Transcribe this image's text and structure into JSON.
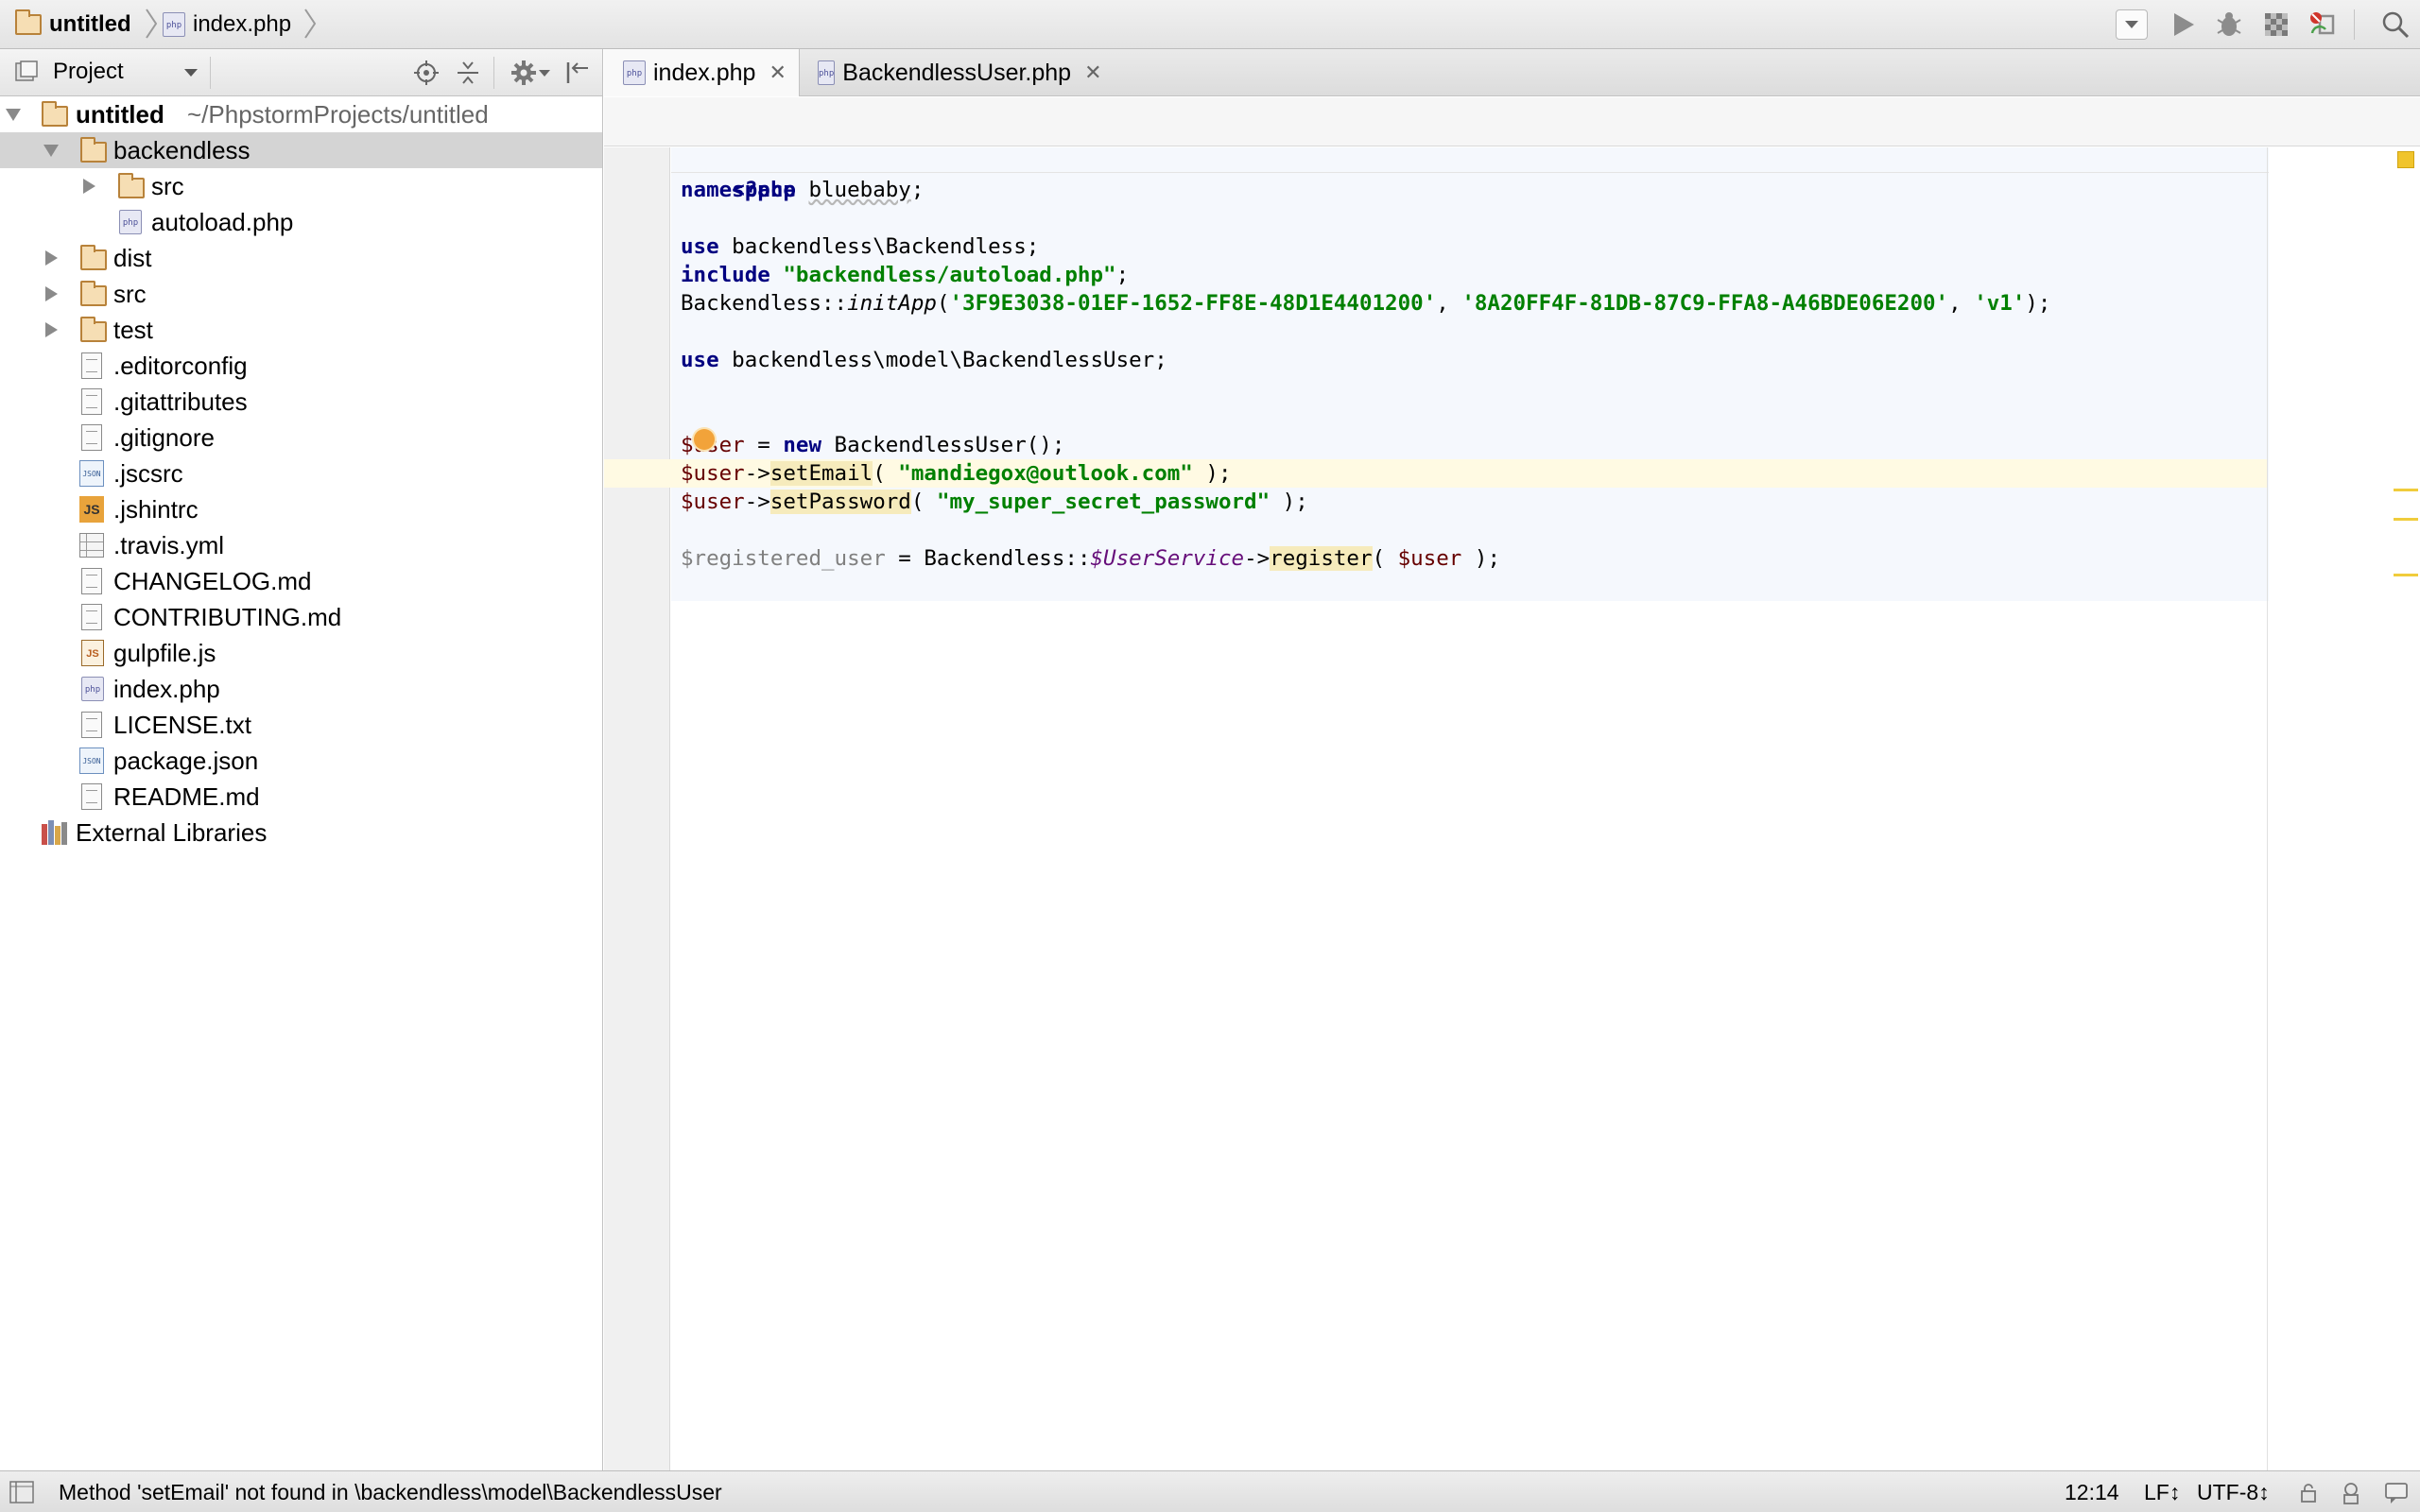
{
  "breadcrumb": {
    "project": "untitled",
    "file": "index.php"
  },
  "toolbar": {
    "run_config_dropdown": "chevron-down-icon",
    "buttons": [
      "run-icon",
      "debug-icon",
      "coverage-icon",
      "stop-icon",
      "search-icon"
    ]
  },
  "project_panel": {
    "title": "Project",
    "tree": {
      "root_name": "untitled",
      "root_path": "~/PhpstormProjects/untitled",
      "items": [
        {
          "label": "backendless",
          "type": "folder"
        },
        {
          "label": "src",
          "type": "folder"
        },
        {
          "label": "autoload.php",
          "type": "php"
        },
        {
          "label": "dist",
          "type": "folder"
        },
        {
          "label": "src",
          "type": "folder"
        },
        {
          "label": "test",
          "type": "folder"
        },
        {
          "label": ".editorconfig",
          "type": "text"
        },
        {
          "label": ".gitattributes",
          "type": "text"
        },
        {
          "label": ".gitignore",
          "type": "text"
        },
        {
          "label": ".jscsrc",
          "type": "json"
        },
        {
          "label": ".jshintrc",
          "type": "js"
        },
        {
          "label": ".travis.yml",
          "type": "yml"
        },
        {
          "label": "CHANGELOG.md",
          "type": "text"
        },
        {
          "label": "CONTRIBUTING.md",
          "type": "text"
        },
        {
          "label": "gulpfile.js",
          "type": "jsfile"
        },
        {
          "label": "index.php",
          "type": "php"
        },
        {
          "label": "LICENSE.txt",
          "type": "text"
        },
        {
          "label": "package.json",
          "type": "json"
        },
        {
          "label": "README.md",
          "type": "text"
        }
      ],
      "external": "External Libraries"
    }
  },
  "editor": {
    "tabs": [
      {
        "label": "index.php",
        "active": true
      },
      {
        "label": "BackendlessUser.php",
        "active": false
      }
    ],
    "code": {
      "l1": "<?php",
      "l2_kw": "namespace",
      "l2_ns": "bluebaby",
      "l2_end": ";",
      "l4_kw": "use",
      "l4_rest": " backendless\\Backendless;",
      "l5_kw": "include",
      "l5_str": "\"backendless/autoload.php\"",
      "l5_end": ";",
      "l6_cls": "Backendless::",
      "l6_fn": "initApp",
      "l6_open": "(",
      "l6_a1": "'3F9E3038-01EF-1652-FF8E-48D1E4401200'",
      "l6_c1": ", ",
      "l6_a2": "'8A20FF4F-81DB-87C9-FFA8-A46BDE06E200'",
      "l6_c2": ", ",
      "l6_a3": "'v1'",
      "l6_end": ");",
      "l8_kw": "use",
      "l8_rest": " backendless\\model\\BackendlessUser;",
      "l11_var": "$user",
      "l11_eq": " = ",
      "l11_kw": "new",
      "l11_rest": " BackendlessUser();",
      "l12_var": "$user",
      "l12_arrow": "->",
      "l12_fn": "setEmail",
      "l12_open": "( ",
      "l12_str": "\"mandiegox@outlook.com\"",
      "l12_end": " );",
      "l13_var": "$user",
      "l13_arrow": "->",
      "l13_fn": "setPassword",
      "l13_open": "( ",
      "l13_str": "\"my_super_secret_password\"",
      "l13_end": " );",
      "l15_var": "$registered_user",
      "l15_eq": " = Backendless::",
      "l15_stat": "$UserService",
      "l15_arrow": "->",
      "l15_fn": "register",
      "l15_open": "( ",
      "l15_arg": "$user",
      "l15_end": " );"
    }
  },
  "statusbar": {
    "message": "Method 'setEmail' not found in \\backendless\\model\\BackendlessUser",
    "position": "12:14",
    "line_separator": "LF↕",
    "encoding": "UTF-8↕"
  },
  "colors": {
    "keyword": "#000080",
    "string": "#008000",
    "variable": "#660000",
    "static_field": "#660e7a",
    "warning_highlight": "#f6ebbc",
    "selection": "#d4d4d4"
  }
}
